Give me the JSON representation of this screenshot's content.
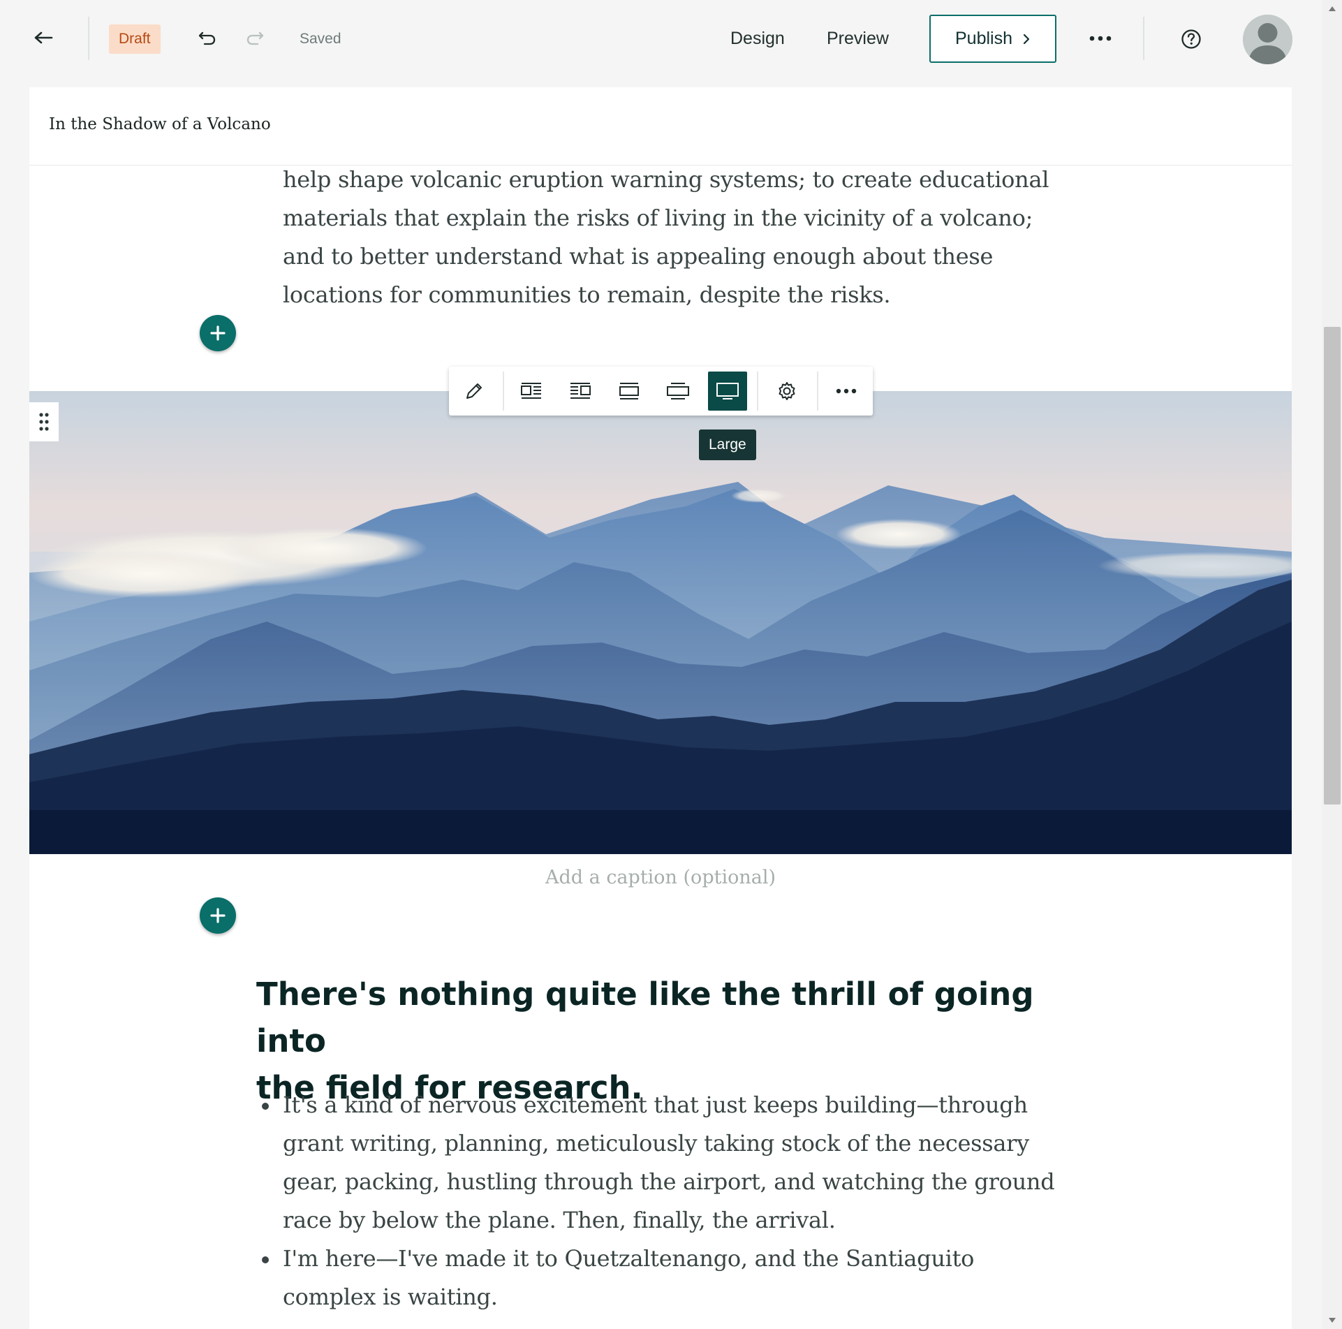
{
  "header": {
    "draft_label": "Draft",
    "saved_label": "Saved",
    "design_label": "Design",
    "preview_label": "Preview",
    "publish_label": "Publish",
    "icons": {
      "back": "arrow-left-icon",
      "undo": "undo-icon",
      "redo": "redo-icon",
      "more": "more-horizontal-icon",
      "help": "help-circle-icon",
      "avatar": "user-avatar-icon"
    }
  },
  "document": {
    "title": "In the Shadow of a Volcano",
    "intro_lines": [
      "help shape volcanic eruption warning systems; to create educational",
      "materials that explain the risks of living in the vicinity of a volcano;",
      "and to better understand what is appealing enough about these",
      "locations for communities to remain, despite the risks."
    ],
    "image_toolbar": {
      "tools": [
        "edit-pencil-icon",
        "float-left-icon",
        "float-right-icon",
        "inline-icon",
        "standard-icon",
        "large-icon",
        "settings-gear-icon",
        "more-horizontal-icon"
      ],
      "active_tool": "large-icon",
      "tooltip": "Large"
    },
    "caption_placeholder": "Add a caption (optional)",
    "heading_lines": [
      "There's nothing quite like the thrill of going into",
      "the field for research."
    ],
    "bullets": [
      [
        "It's a kind of nervous excitement that just keeps building—through",
        "grant writing, planning, meticulously taking stock of the necessary",
        "gear, packing, hustling through the airport, and watching the ground",
        "race by below the plane. Then, finally, the arrival."
      ],
      [
        "I'm here—I've made it to Quetzaltenango, and the Santiaguito",
        "complex is waiting."
      ]
    ]
  },
  "colors": {
    "accent": "#0a6e69",
    "accent_dark": "#0a4a47",
    "draft_bg": "#fbdcc8",
    "draft_text": "#b54a14"
  }
}
